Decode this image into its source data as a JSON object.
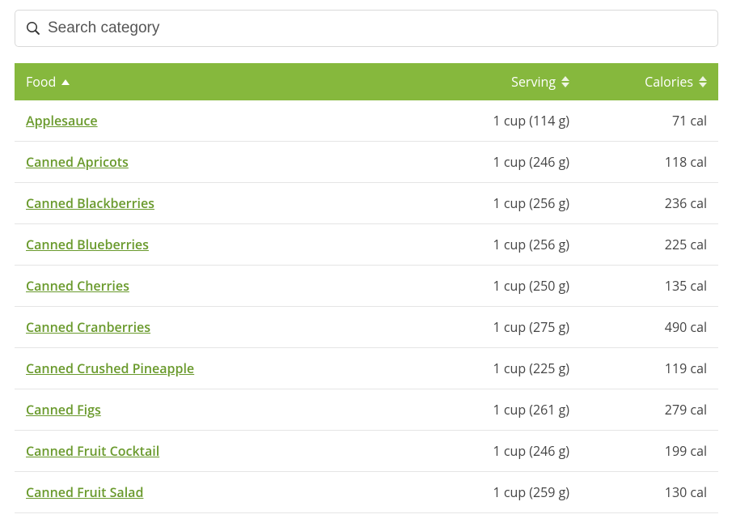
{
  "search": {
    "placeholder": "Search category"
  },
  "columns": {
    "food": "Food",
    "serving": "Serving",
    "calories": "Calories"
  },
  "chart_data": {
    "type": "table",
    "columns": [
      "Food",
      "Serving",
      "Calories"
    ],
    "rows": [
      {
        "food": "Applesauce",
        "serving": "1 cup (114 g)",
        "calories": "71 cal"
      },
      {
        "food": "Canned Apricots",
        "serving": "1 cup (246 g)",
        "calories": "118 cal"
      },
      {
        "food": "Canned Blackberries",
        "serving": "1 cup (256 g)",
        "calories": "236 cal"
      },
      {
        "food": "Canned Blueberries",
        "serving": "1 cup (256 g)",
        "calories": "225 cal"
      },
      {
        "food": "Canned Cherries",
        "serving": "1 cup (250 g)",
        "calories": "135 cal"
      },
      {
        "food": "Canned Cranberries",
        "serving": "1 cup (275 g)",
        "calories": "490 cal"
      },
      {
        "food": "Canned Crushed Pineapple",
        "serving": "1 cup (225 g)",
        "calories": "119 cal"
      },
      {
        "food": "Canned Figs",
        "serving": "1 cup (261 g)",
        "calories": "279 cal"
      },
      {
        "food": "Canned Fruit Cocktail",
        "serving": "1 cup (246 g)",
        "calories": "199 cal"
      },
      {
        "food": "Canned Fruit Salad",
        "serving": "1 cup (259 g)",
        "calories": "130 cal"
      }
    ]
  }
}
